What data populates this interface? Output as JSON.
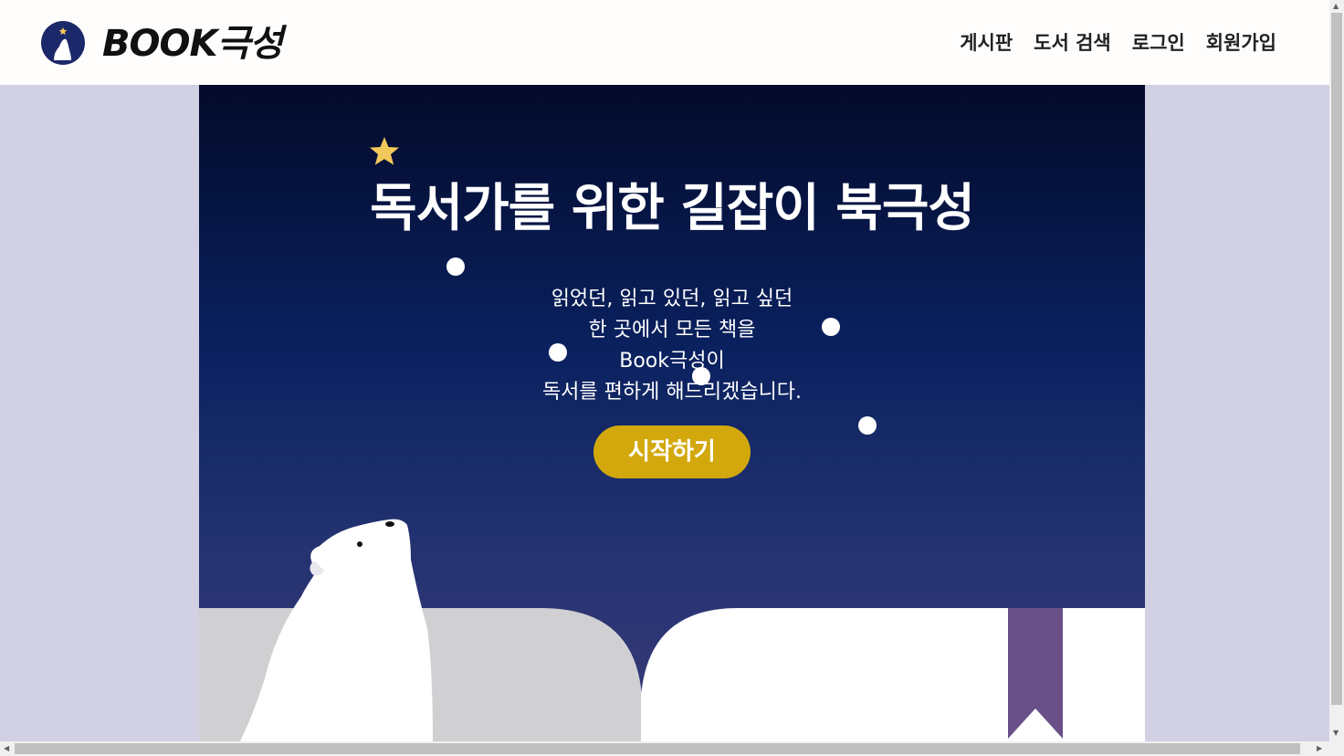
{
  "header": {
    "logo_text": "BOOK극성",
    "nav": [
      "게시판",
      "도서 검색",
      "로그인",
      "회원가입"
    ]
  },
  "hero": {
    "title": "독서가를 위한 길잡이 북극성",
    "lines": [
      "읽었던, 읽고 있던, 읽고 싶던",
      "한 곳에서 모든 책을",
      "Book극성이",
      "독서를 편하게 해드리겠습니다."
    ],
    "cta": "시작하기"
  },
  "colors": {
    "brand_navy": "#1b2869",
    "cta_gold": "#d2a80d",
    "bookmark_purple": "#6a5088",
    "star_gold": "#f3c85a"
  },
  "icons": [
    "logo-bear-icon",
    "star-icon",
    "polar-bear-illustration",
    "bookmark-ribbon"
  ]
}
